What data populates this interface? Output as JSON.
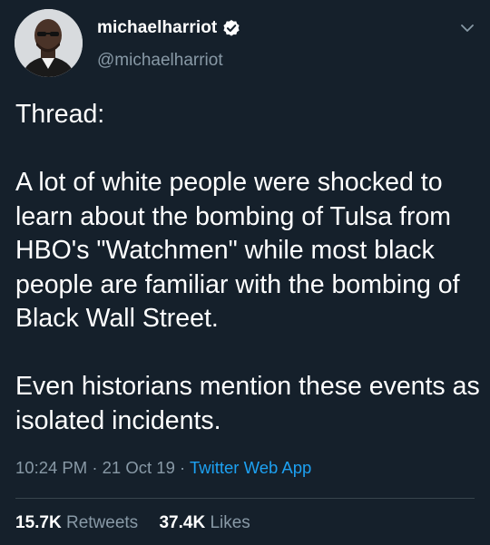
{
  "user": {
    "display_name": "michaelharriot",
    "handle": "@michaelharriot"
  },
  "tweet": {
    "intro": "Thread:",
    "paragraph1": "A lot of white people were shocked to learn about the bombing of Tulsa from HBO's \"Watchmen\" while most black people are familiar with the bombing of Black Wall Street.",
    "paragraph2": "Even historians mention these events as isolated incidents."
  },
  "meta": {
    "time": "10:24 PM",
    "separator": "·",
    "date": "21 Oct 19",
    "source": "Twitter Web App"
  },
  "stats": {
    "retweets_count": "15.7K",
    "retweets_label": "Retweets",
    "likes_count": "37.4K",
    "likes_label": "Likes"
  },
  "colors": {
    "background": "#15202b",
    "secondary_text": "#8899a6",
    "accent": "#1da1f2"
  },
  "icons": {
    "verified": "verified-badge-icon",
    "menu": "chevron-down-icon"
  }
}
